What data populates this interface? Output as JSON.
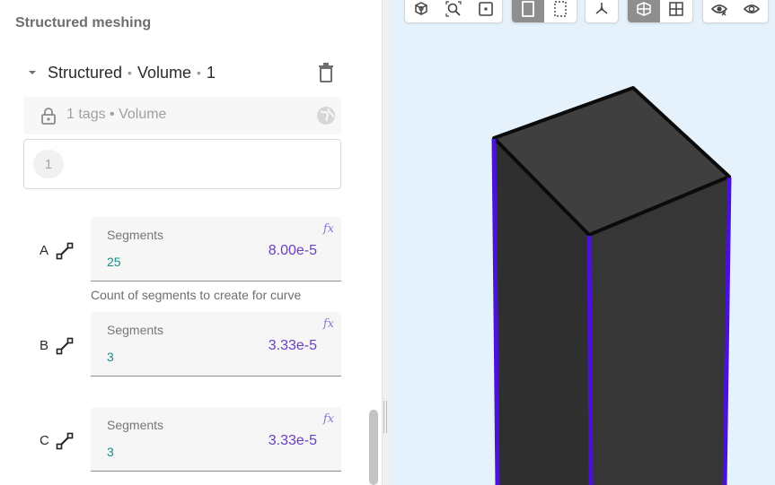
{
  "panel": {
    "title": "Structured meshing",
    "group": {
      "name": "Structured",
      "kind": "Volume",
      "index": "1",
      "tag_summary": "1 tags • Volume",
      "tags": [
        "1"
      ]
    },
    "curves": [
      {
        "letter": "A",
        "field_label": "Segments",
        "value": "25",
        "length": "8.00e-5",
        "fx": "fx",
        "helper": "Count of segments to create for curve"
      },
      {
        "letter": "B",
        "field_label": "Segments",
        "value": "3",
        "length": "3.33e-5",
        "fx": "fx"
      },
      {
        "letter": "C",
        "field_label": "Segments",
        "value": "3",
        "length": "3.33e-5",
        "fx": "fx"
      }
    ]
  },
  "toolbar": {
    "buttons": [
      {
        "name": "view-cube-icon"
      },
      {
        "name": "zoom-fit-icon"
      },
      {
        "name": "frame-selection-icon"
      },
      {
        "name": "solid-view-icon",
        "active": true
      },
      {
        "name": "wireframe-view-icon"
      },
      {
        "name": "axes-icon"
      },
      {
        "name": "section-plane-icon",
        "active": true
      },
      {
        "name": "grid-icon"
      },
      {
        "name": "show-hidden-icon"
      },
      {
        "name": "visibility-icon"
      }
    ]
  },
  "colors": {
    "accent": "#6b3fc4",
    "value_teal": "#1a8c87",
    "viewport_bg": "#e6f2fb",
    "box_face": "#333333",
    "box_top": "#3d3d3d",
    "edge_highlight": "#4a12d9"
  }
}
